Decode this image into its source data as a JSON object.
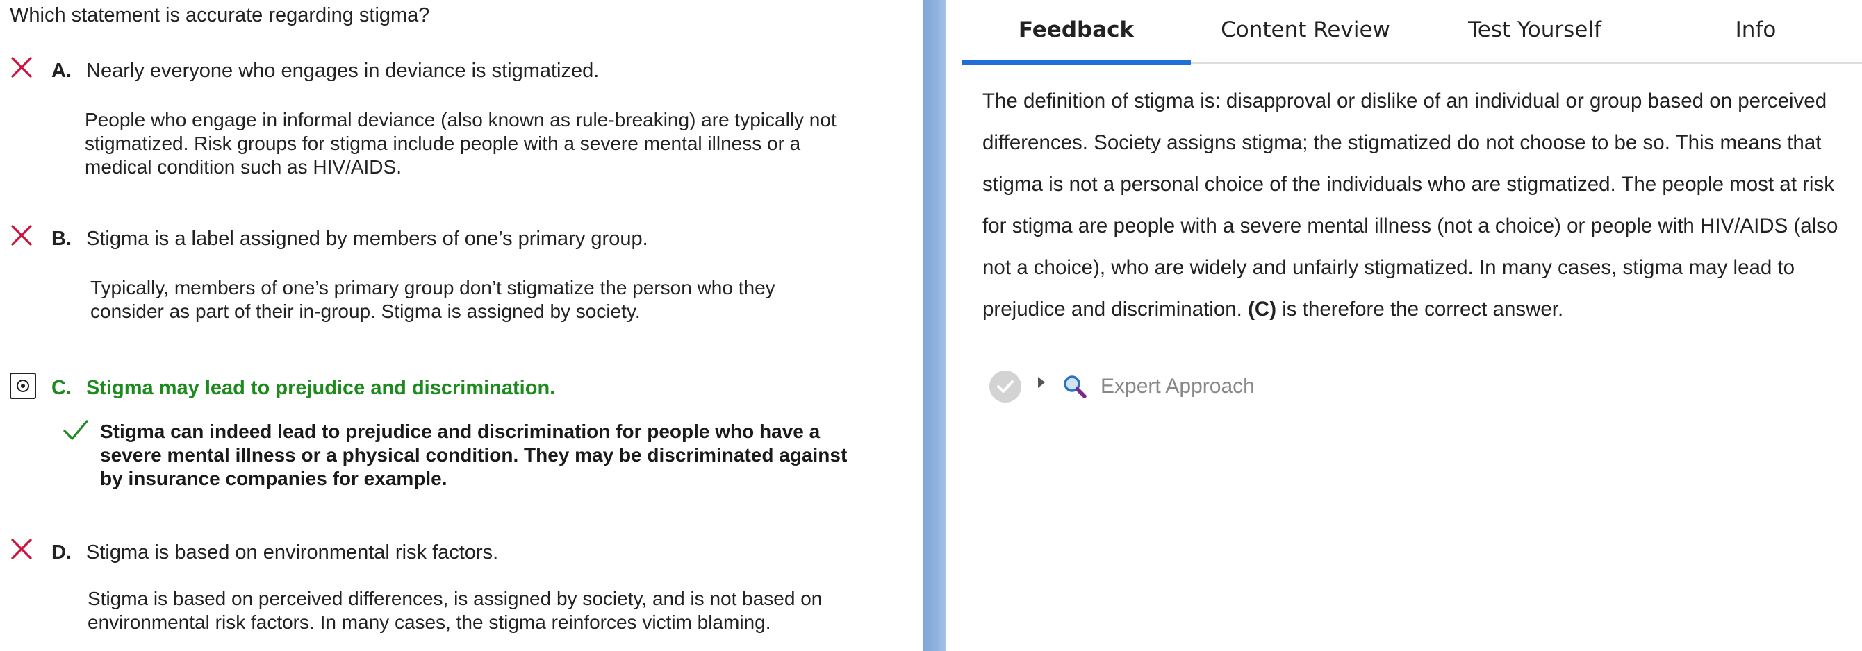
{
  "question": {
    "prompt": "Which statement is accurate regarding stigma?"
  },
  "choices": [
    {
      "letter": "A.",
      "status": "incorrect",
      "statement": "Nearly everyone who engages in deviance is stigmatized.",
      "explanation_lines": [
        "People who engage in informal deviance (also known as rule-breaking) are typically not",
        "stigmatized. Risk groups for stigma include people with a severe mental illness or a",
        "medical condition such as HIV/AIDS."
      ]
    },
    {
      "letter": "B.",
      "status": "incorrect",
      "statement": "Stigma is a label assigned by members of one’s primary group.",
      "explanation_lines": [
        "Typically, members of one’s primary group don’t stigmatize the person who they",
        "consider as part of their in-group. Stigma is assigned by society."
      ]
    },
    {
      "letter": "C.",
      "status": "correct",
      "selected": true,
      "statement": "Stigma may lead to prejudice and discrimination.",
      "explanation_lines": [
        "Stigma can indeed lead to prejudice and discrimination for people who have a",
        "severe mental illness or a physical condition. They may be discriminated against",
        "by insurance companies for example."
      ]
    },
    {
      "letter": "D.",
      "status": "incorrect",
      "statement": "Stigma is based on environmental risk factors.",
      "explanation_lines": [
        "Stigma is based on perceived differences, is assigned by society, and is not based on",
        "environmental risk factors. In many cases, the stigma reinforces victim blaming."
      ]
    }
  ],
  "tabs": [
    {
      "label": "Feedback",
      "active": true
    },
    {
      "label": "Content Review",
      "active": false
    },
    {
      "label": "Test Yourself",
      "active": false
    },
    {
      "label": "Info",
      "active": false
    }
  ],
  "feedback": {
    "lines": [
      "The definition of stigma is: disapproval or dislike of an individual or group based on perceived",
      "differences. Society assigns stigma; the stigmatized do not choose to be so. This means that",
      "stigma is not a personal choice of the individuals who are stigmatized. The people most at risk",
      "for stigma are people with a severe mental illness (not a choice) or people with HIV/AIDS (also",
      "not a choice), who are widely and unfairly stigmatized. In many cases, stigma may lead to"
    ],
    "last_line_before": "prejudice and discrimination. ",
    "last_line_bold": "(C)",
    "last_line_after": " is therefore the correct answer."
  },
  "expert_approach": {
    "label": "Expert Approach",
    "icon": "magnifier-icon"
  },
  "colors": {
    "correct_green": "#1d8a1d",
    "incorrect_red": "#d0103a",
    "tab_underline": "#1f6fd6",
    "divider_blue": "#8fb3e0"
  }
}
